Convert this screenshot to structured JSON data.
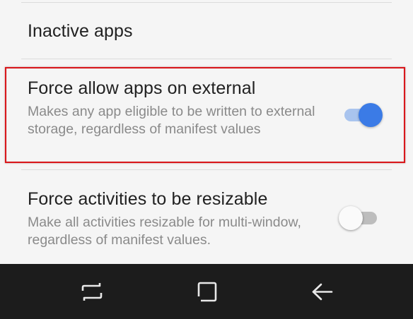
{
  "settings": {
    "inactive_apps": {
      "title": "Inactive apps"
    },
    "force_external": {
      "title": "Force allow apps on external",
      "summary": "Makes any app eligible to be written to external storage, regardless of manifest values",
      "enabled": true
    },
    "force_resizable": {
      "title": "Force activities to be resizable",
      "summary": "Make all activities resizable for multi-window, regardless of manifest values.",
      "enabled": false
    }
  },
  "colors": {
    "accent": "#3b7be6",
    "highlight": "#d9181c",
    "navbar": "#1c1c1c"
  },
  "navbar": {
    "icons": [
      "recent-apps-icon",
      "home-icon",
      "back-icon"
    ]
  }
}
